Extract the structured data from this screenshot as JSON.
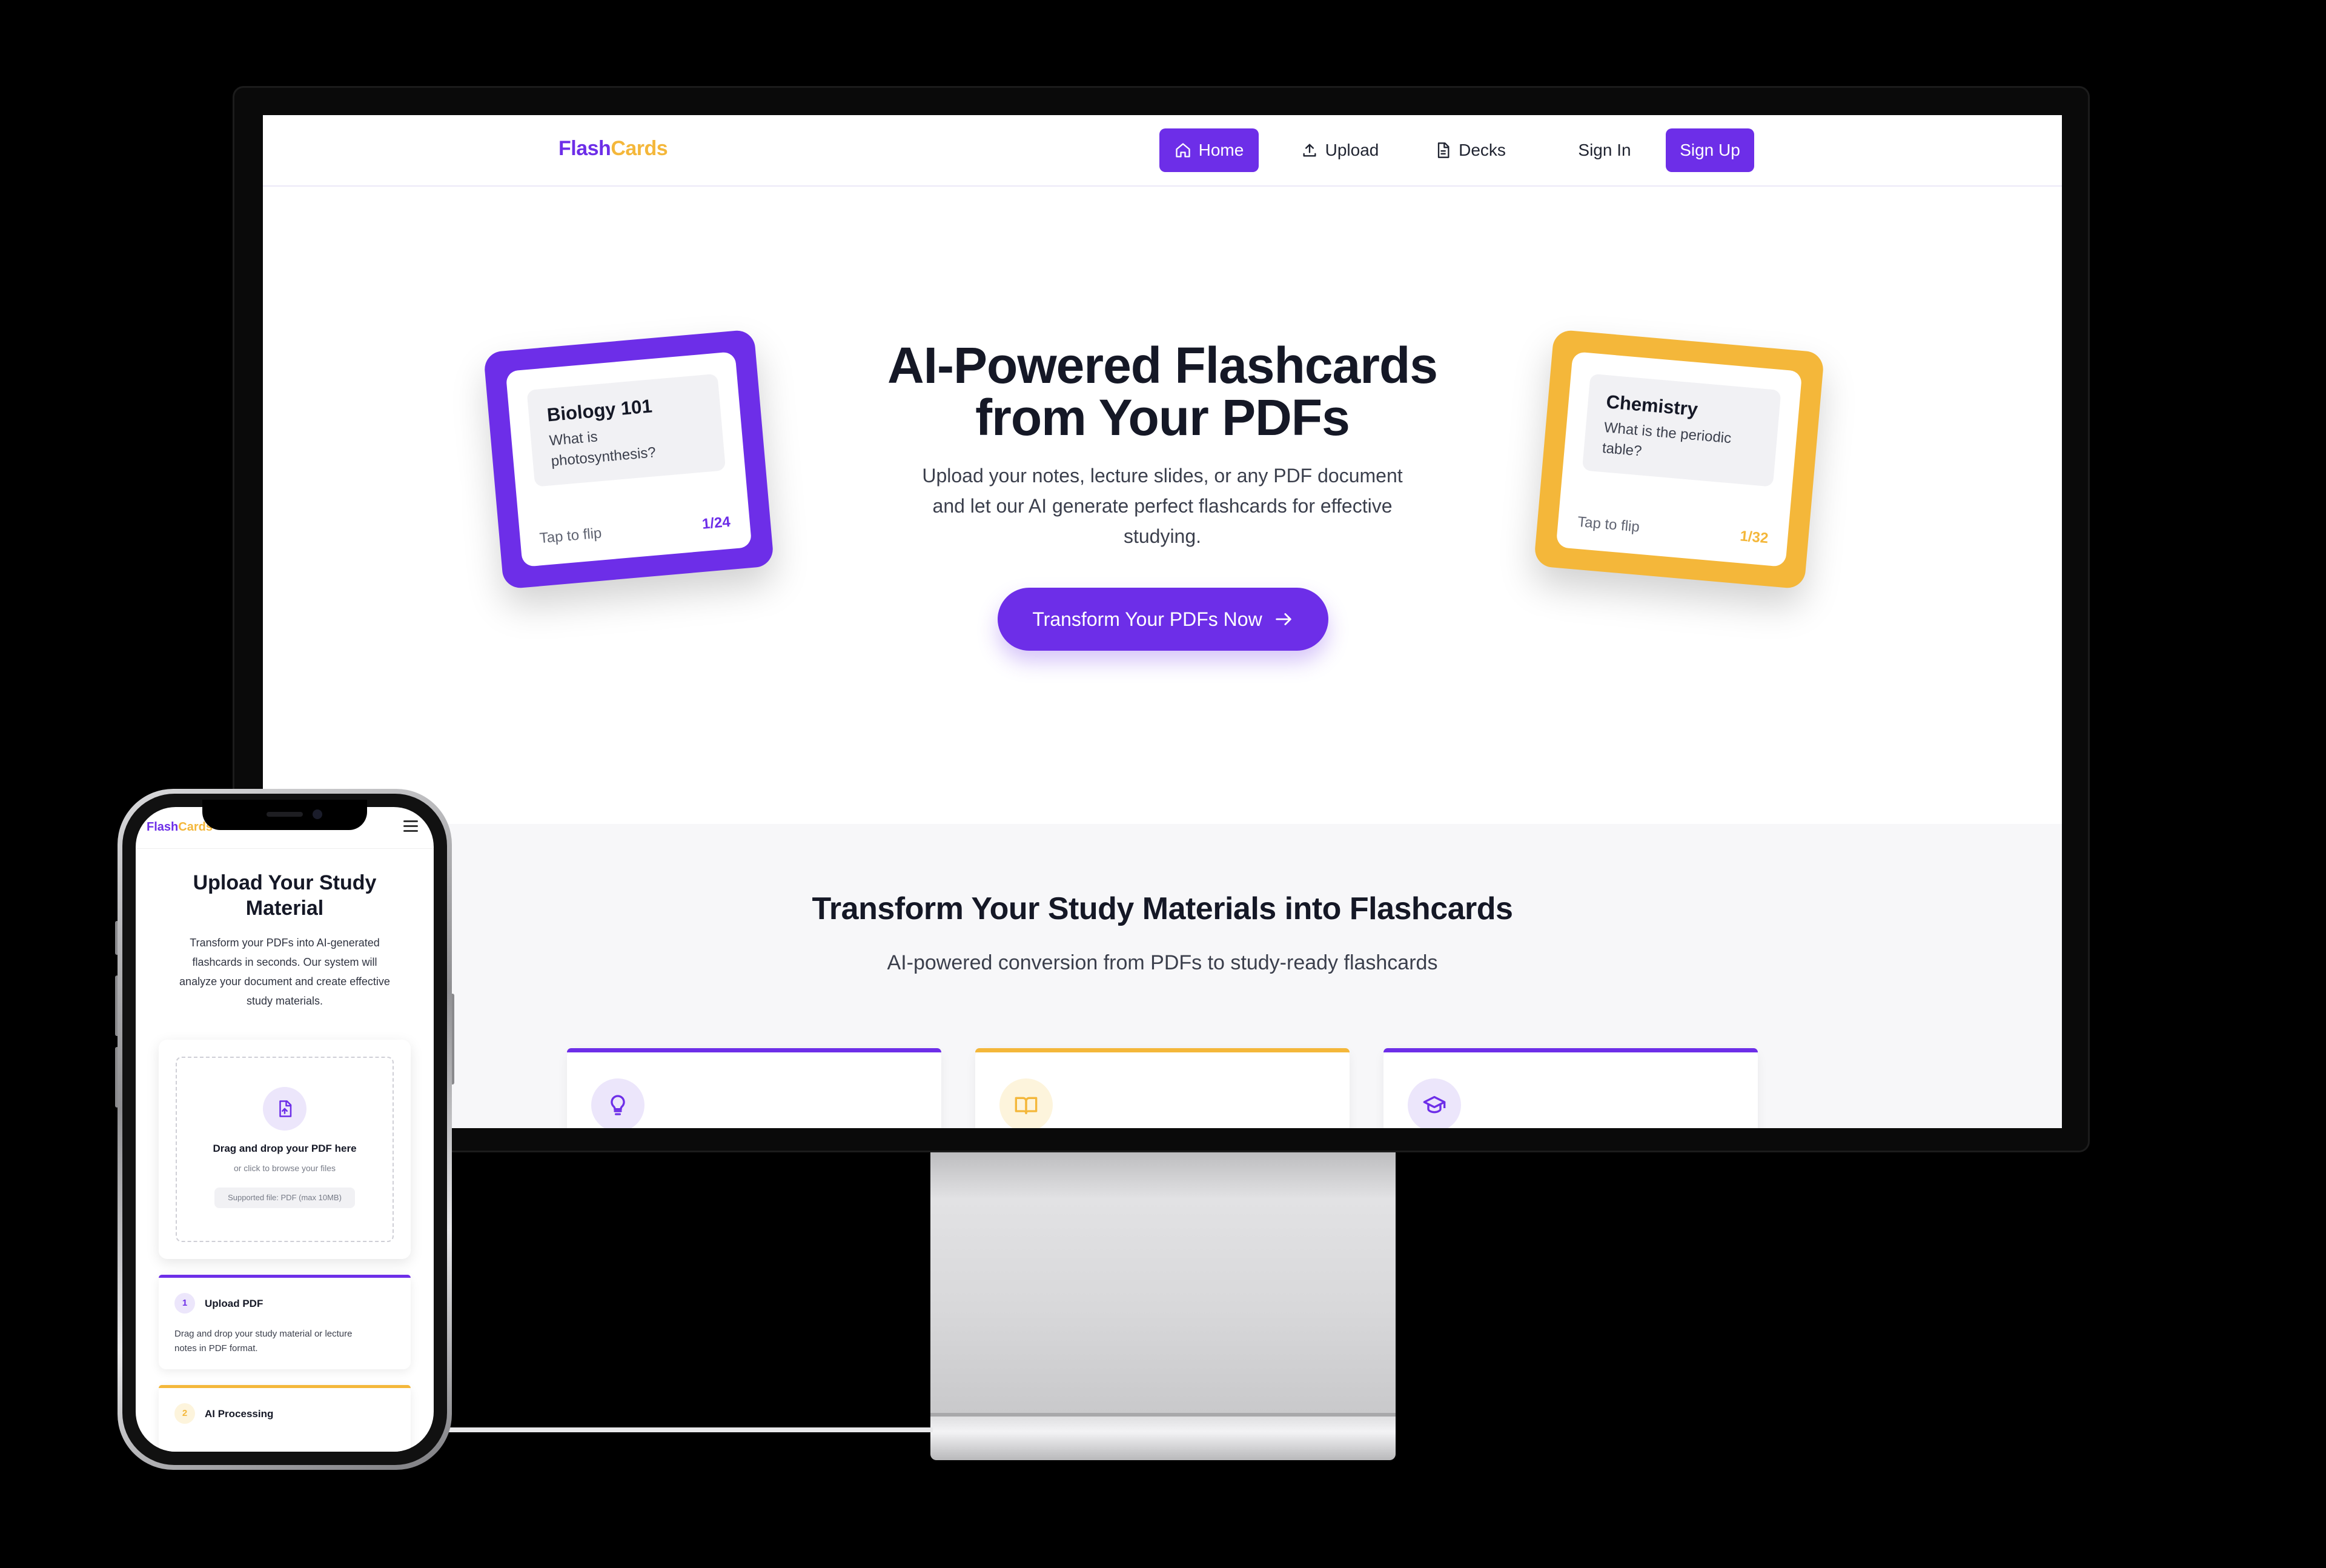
{
  "desktop": {
    "nav": {
      "logo_part1": "Flash",
      "logo_part2": "Cards",
      "home": "Home",
      "upload": "Upload",
      "decks": "Decks",
      "sign_in": "Sign In",
      "sign_up": "Sign Up"
    },
    "hero": {
      "title_line1": "AI-Powered Flashcards",
      "title_line2": "from Your PDFs",
      "subtitle_line1": "Upload your notes, lecture slides, or any PDF document",
      "subtitle_line2": "and let our AI generate perfect flashcards for effective",
      "subtitle_line3": "studying.",
      "cta": "Transform Your PDFs Now"
    },
    "card_left": {
      "subject": "Biology 101",
      "question": "What is photosynthesis?",
      "hint": "Tap to flip",
      "counter": "1/24",
      "color": "#6d2ee8"
    },
    "card_right": {
      "subject": "Chemistry",
      "question": "What is the periodic table?",
      "hint": "Tap to flip",
      "counter": "1/32",
      "color": "#f4b73a"
    },
    "features": {
      "title": "Transform Your Study Materials into Flashcards",
      "subtitle": "AI-powered conversion from PDFs to study-ready flashcards",
      "items": [
        {
          "icon": "lightbulb-icon",
          "accent": "#6d2ee8"
        },
        {
          "icon": "book-open-icon",
          "accent": "#f4b73a"
        },
        {
          "icon": "graduation-cap-icon",
          "accent": "#6d2ee8"
        }
      ]
    }
  },
  "mobile": {
    "logo_part1": "Flash",
    "logo_part2": "Cards",
    "title_line1": "Upload Your Study",
    "title_line2": "Material",
    "desc_line1": "Transform your PDFs into AI-generated",
    "desc_line2": "flashcards in seconds. Our system will",
    "desc_line3": "analyze your document and create effective",
    "desc_line4": "study materials.",
    "dropzone": {
      "main": "Drag and drop your PDF here",
      "sub": "or click to browse your files",
      "badge": "Supported file: PDF (max 10MB)"
    },
    "steps": [
      {
        "num": "1",
        "title": "Upload PDF",
        "desc_line1": "Drag and drop your study material or lecture",
        "desc_line2": "notes in PDF format."
      },
      {
        "num": "2",
        "title": "AI Processing"
      }
    ]
  },
  "colors": {
    "primary": "#6d2ee8",
    "accent": "#f4b73a"
  }
}
